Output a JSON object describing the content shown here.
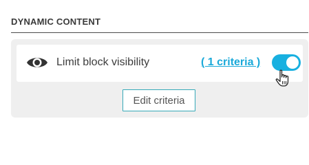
{
  "section": {
    "title": "DYNAMIC CONTENT"
  },
  "visibility_row": {
    "icon": "eye-icon",
    "label": "Limit block visibility",
    "criteria_link": "( 1 criteria )",
    "toggle_state": "on"
  },
  "edit_button": {
    "label": "Edit criteria"
  },
  "colors": {
    "accent": "#1aa9d9",
    "toggle_on": "#18b0e0",
    "button_border": "#35a9b8",
    "panel_bg": "#efefef"
  }
}
